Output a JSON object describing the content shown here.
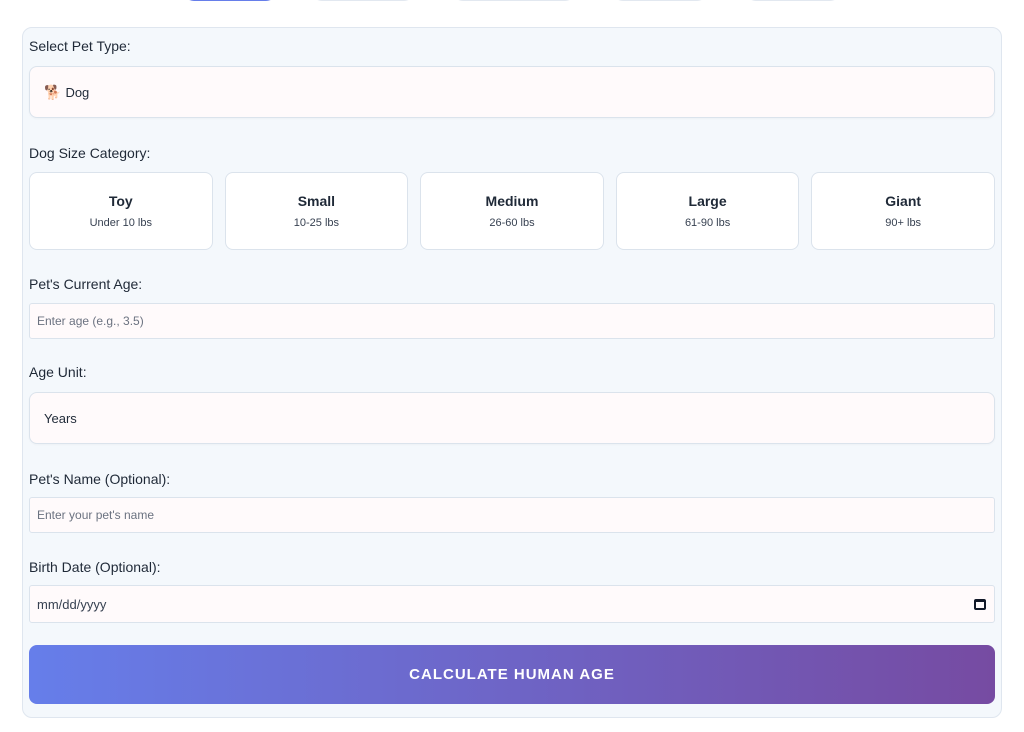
{
  "pet_type": {
    "label": "Select Pet Type:",
    "icon": "dog-icon",
    "icon_glyph": "🐕",
    "value": "Dog"
  },
  "size_category": {
    "label": "Dog Size Category:",
    "options": [
      {
        "name": "Toy",
        "range": "Under 10 lbs"
      },
      {
        "name": "Small",
        "range": "10-25 lbs"
      },
      {
        "name": "Medium",
        "range": "26-60 lbs"
      },
      {
        "name": "Large",
        "range": "61-90 lbs"
      },
      {
        "name": "Giant",
        "range": "90+ lbs"
      }
    ]
  },
  "age": {
    "label": "Pet's Current Age:",
    "placeholder": "Enter age (e.g., 3.5)"
  },
  "age_unit": {
    "label": "Age Unit:",
    "value": "Years"
  },
  "pet_name": {
    "label": "Pet's Name (Optional):",
    "placeholder": "Enter your pet's name"
  },
  "birth_date": {
    "label": "Birth Date (Optional):",
    "placeholder": "mm/dd/yyyy",
    "icon": "calendar-icon"
  },
  "calculate_button": {
    "label": "CALCULATE HUMAN AGE"
  },
  "colors": {
    "accent_start": "#667eea",
    "accent_end": "#764ba2",
    "card_bg": "#f4f8fc"
  }
}
